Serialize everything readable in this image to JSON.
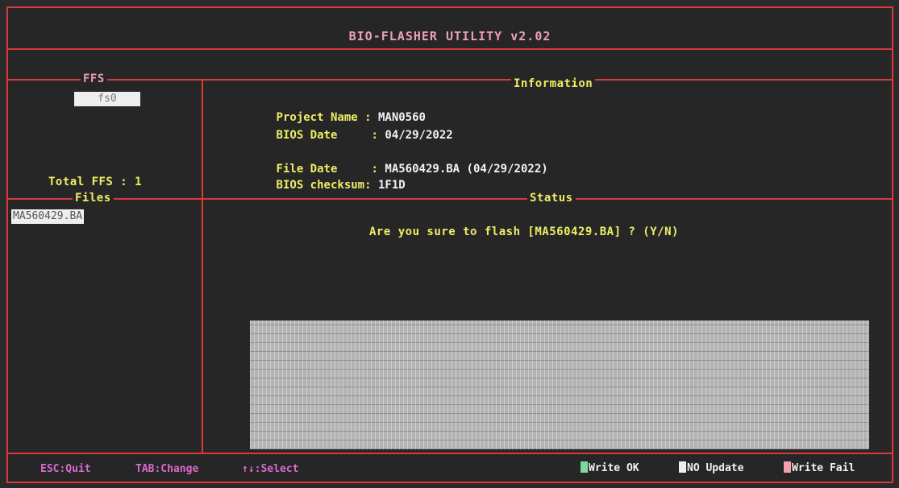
{
  "title": "BIO-FLASHER UTILITY v2.02",
  "ffs": {
    "header": "FFS",
    "selected": "fs0",
    "total_label": "Total FFS : 1"
  },
  "files": {
    "header": "Files",
    "items": [
      "MA560429.BA"
    ]
  },
  "information": {
    "header": "Information",
    "project_name_key": "Project Name : ",
    "project_name_val": "MAN0560",
    "bios_date_key": "BIOS Date     : ",
    "bios_date_val": "04/29/2022",
    "file_date_key": "File Date     : ",
    "file_date_val": "MA560429.BA (04/29/2022)",
    "checksum_key": "BIOS checksum: ",
    "checksum_val": "1F1D"
  },
  "status": {
    "header": "Status",
    "prompt": "Are you sure to flash [MA560429.BA] ? (Y/N)"
  },
  "footer": {
    "esc": "ESC:Quit",
    "tab": "TAB:Change",
    "select": "↑↓:Select",
    "legend": [
      {
        "label": "Write OK",
        "color": "#7ed9a0"
      },
      {
        "label": "NO Update",
        "color": "#eeeeee"
      },
      {
        "label": "Write Fail",
        "color": "#f4a0b0"
      }
    ]
  },
  "colors": {
    "border": "#d93a3a",
    "background": "#262626",
    "label": "#eeee66",
    "value": "#f2f2f2",
    "title": "#f0a0b4"
  }
}
